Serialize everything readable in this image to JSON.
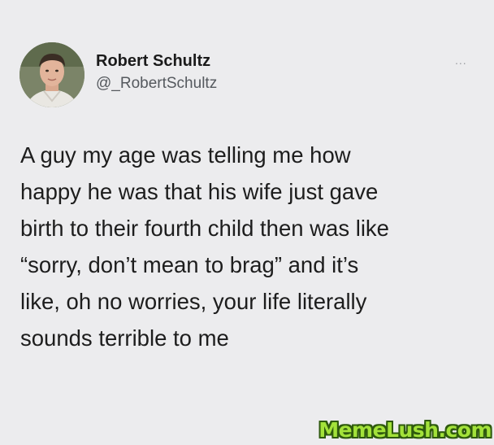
{
  "author": {
    "name": "Robert Schultz",
    "handle": "@_RobertSchultz"
  },
  "menu": {
    "more_label": "..."
  },
  "tweet": {
    "lines": [
      "A guy my age was telling me how",
      "happy he was that his wife just gave",
      "birth to their fourth child then was like",
      "“sorry, don’t mean to brag” and it’s",
      "like, oh no worries, your life literally",
      "sounds terrible to me"
    ]
  },
  "watermark": {
    "text": "MemeLush.com"
  }
}
